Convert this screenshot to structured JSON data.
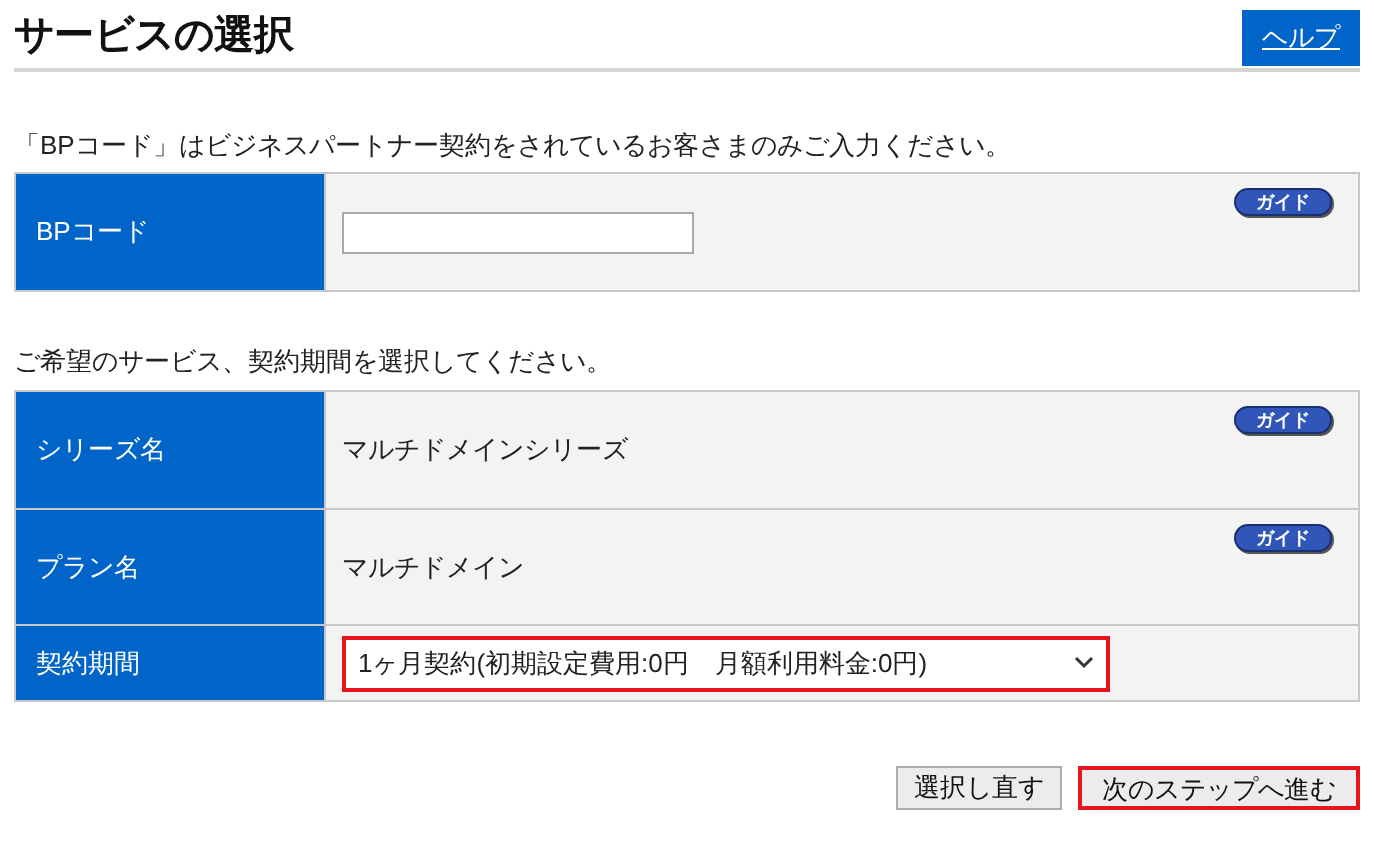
{
  "title": "サービスの選択",
  "help_link": "ヘルプ",
  "bp_notice": "「BPコード」はビジネスパートナー契約をされているお客さまのみご入力ください。",
  "bp_table": {
    "rows": [
      {
        "kind": "input",
        "label": "BPコード",
        "guide": "ガイド"
      }
    ]
  },
  "service_notice": "ご希望のサービス、契約期間を選択してください。",
  "service_table": {
    "rows": [
      {
        "kind": "text",
        "label": "シリーズ名",
        "value": "マルチドメインシリーズ",
        "guide": "ガイド"
      },
      {
        "kind": "text",
        "label": "プラン名",
        "value": "マルチドメイン",
        "guide": "ガイド"
      },
      {
        "kind": "select",
        "label": "契約期間",
        "value": "1ヶ月契約(初期設定費用:0円　月額利用料金:0円)",
        "highlighted": true
      }
    ]
  },
  "buttons": [
    {
      "label": "選択し直す",
      "highlighted": false
    },
    {
      "label": "次のステップへ進む",
      "highlighted": true
    }
  ]
}
